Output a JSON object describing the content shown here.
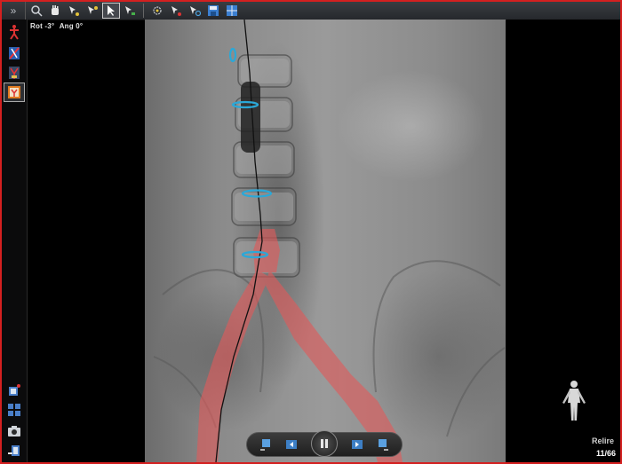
{
  "toolbar": {
    "expand_glyph": "»",
    "tools": [
      {
        "icon": "zoom-icon"
      },
      {
        "icon": "pan-hand-icon"
      },
      {
        "icon": "select-point-icon"
      },
      {
        "icon": "measure-icon"
      },
      {
        "icon": "cursor-icon",
        "active": true
      },
      {
        "icon": "annotate-icon"
      },
      {
        "icon": "rotate-icon"
      },
      {
        "icon": "marker-icon"
      },
      {
        "icon": "reset-icon"
      },
      {
        "icon": "save-icon"
      },
      {
        "icon": "layout-icon"
      }
    ]
  },
  "sidebar": {
    "items": [
      {
        "icon": "patient-position-icon"
      },
      {
        "icon": "vessel-overlay-icon"
      },
      {
        "icon": "roadmap-icon"
      },
      {
        "icon": "fusion-view-icon",
        "active": true
      },
      {
        "icon": "add-layer-icon"
      },
      {
        "icon": "grid-layout-icon"
      },
      {
        "icon": "camera-icon"
      },
      {
        "icon": "export-icon"
      }
    ]
  },
  "view_info": {
    "rotation": "Rot -3°",
    "angulation": "Ang  0°"
  },
  "playback": {
    "controls": [
      "first-frame-icon",
      "previous-frame-icon",
      "pause-icon",
      "next-frame-icon",
      "last-frame-icon"
    ]
  },
  "status": {
    "view_label": "Relire",
    "frame_counter": "11/66"
  },
  "colors": {
    "frame_border": "#d42020",
    "vessel_overlay": "#e05a5a",
    "marker_ring": "#2aa8d8"
  }
}
